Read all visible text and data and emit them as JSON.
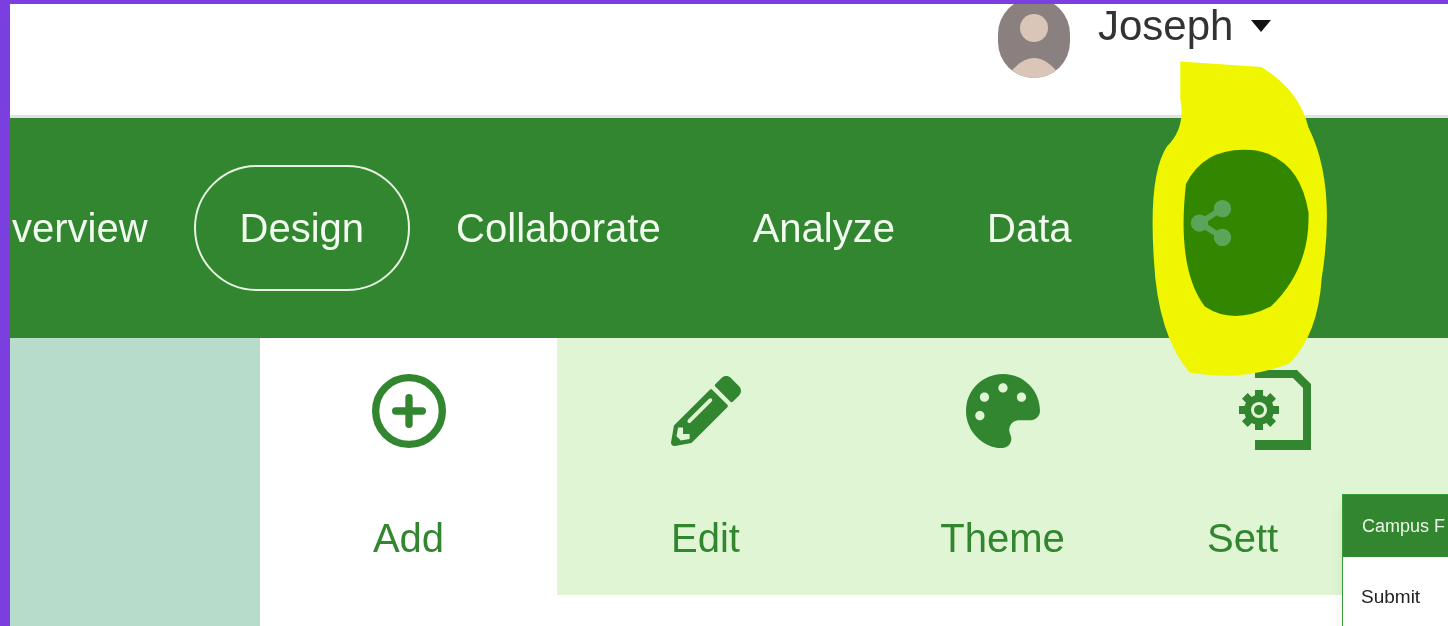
{
  "header": {
    "user_name": "Joseph"
  },
  "nav": {
    "tabs": [
      {
        "label": "verview",
        "selected": false
      },
      {
        "label": "Design",
        "selected": true
      },
      {
        "label": "Collaborate",
        "selected": false
      },
      {
        "label": "Analyze",
        "selected": false
      },
      {
        "label": "Data",
        "selected": false
      }
    ]
  },
  "toolbar": {
    "items": [
      {
        "kind": "add",
        "label": "Add",
        "active": false,
        "truncated": false
      },
      {
        "kind": "edit",
        "label": "Edit",
        "active": true,
        "truncated": false
      },
      {
        "kind": "theme",
        "label": "Theme",
        "active": true,
        "truncated": false
      },
      {
        "kind": "settings",
        "label": "Sett",
        "active": true,
        "truncated": true
      }
    ]
  },
  "popup": {
    "title": "Campus F",
    "items": [
      "Submit"
    ]
  }
}
